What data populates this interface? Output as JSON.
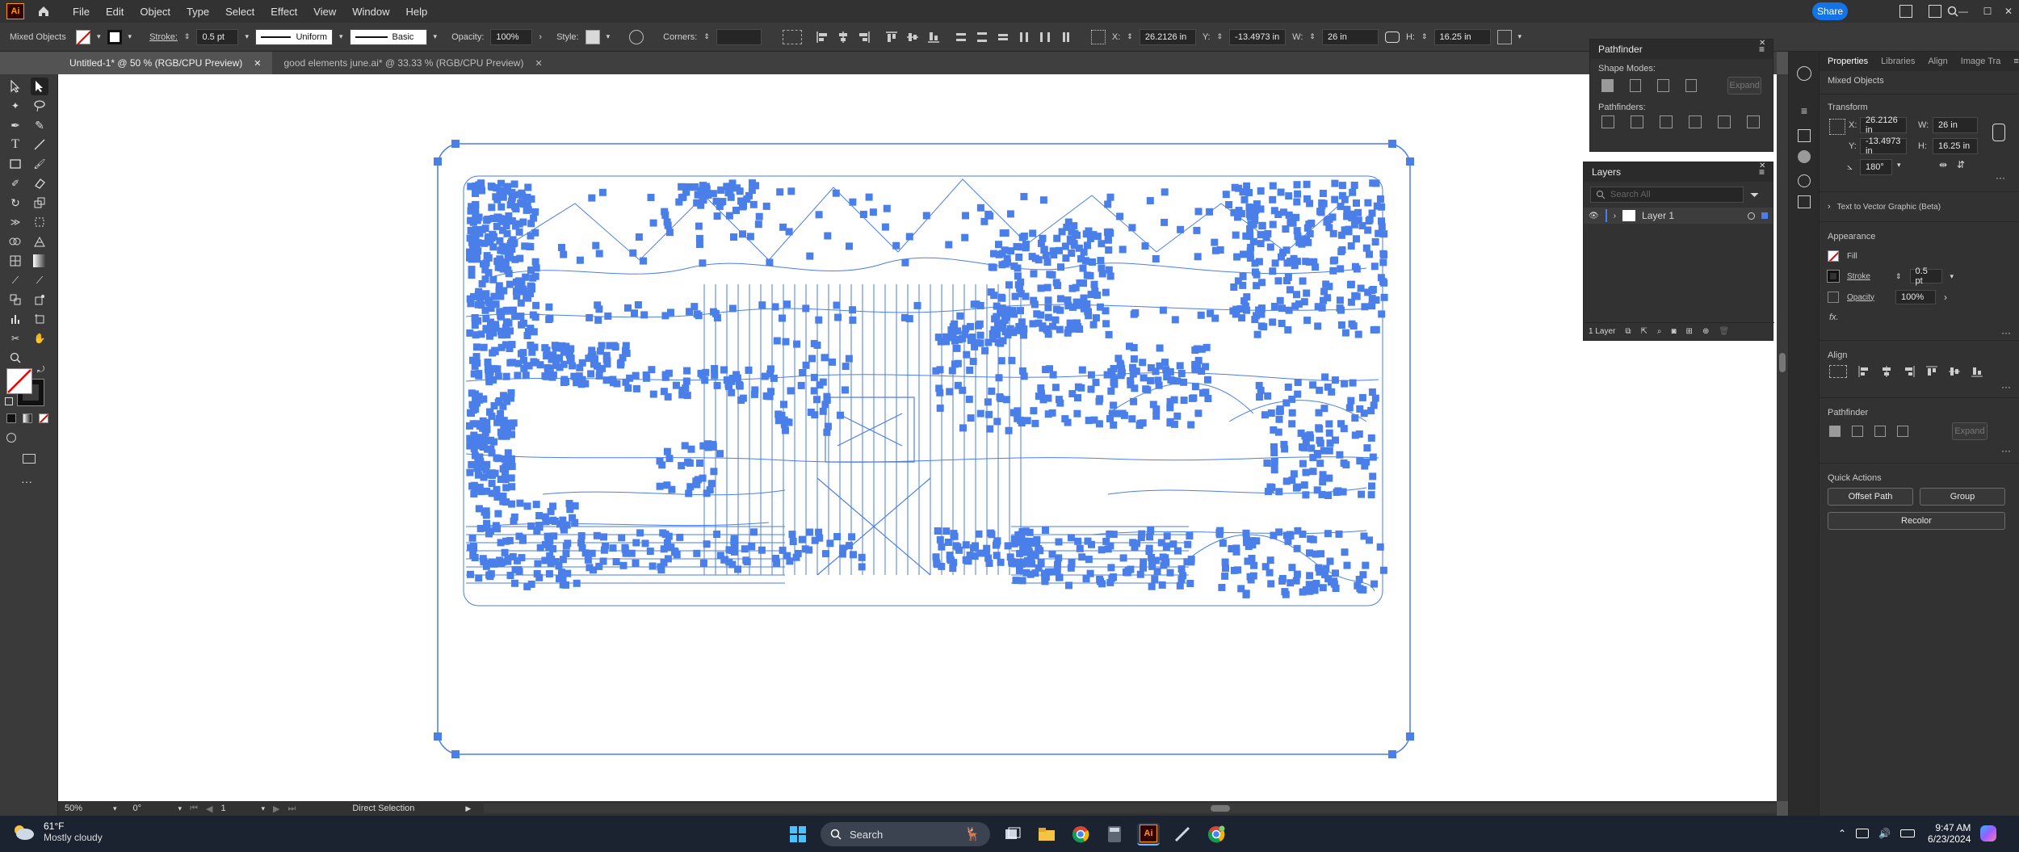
{
  "app": {
    "logo": "Ai",
    "home_icon": "home-icon"
  },
  "menu": [
    "File",
    "Edit",
    "Object",
    "Type",
    "Select",
    "Effect",
    "View",
    "Window",
    "Help"
  ],
  "window": {
    "share_label": "Share"
  },
  "control_bar": {
    "selection_label": "Mixed Objects",
    "stroke_label": "Stroke:",
    "stroke_value": "0.5 pt",
    "profile_value": "Uniform",
    "brush_value": "Basic",
    "opacity_label": "Opacity:",
    "opacity_value": "100%",
    "style_label": "Style:",
    "corners_label": "Corners:",
    "x_label": "X:",
    "x_value": "26.2126 in",
    "y_label": "Y:",
    "y_value": "-13.4973 in",
    "w_label": "W:",
    "w_value": "26 in",
    "h_label": "H:",
    "h_value": "16.25 in"
  },
  "tabs": [
    {
      "label": "Untitled-1* @ 50 % (RGB/CPU Preview)",
      "active": true
    },
    {
      "label": "good elements june.ai* @ 33.33 % (RGB/CPU Preview)",
      "active": false
    }
  ],
  "status_bar": {
    "zoom": "50%",
    "rotation": "0°",
    "artboard": "1",
    "tool": "Direct Selection"
  },
  "pathfinder_panel": {
    "title": "Pathfinder",
    "shape_modes_label": "Shape Modes:",
    "expand_label": "Expand",
    "pathfinders_label": "Pathfinders:"
  },
  "layers_panel": {
    "title": "Layers",
    "search_placeholder": "Search All",
    "layer_name": "Layer 1",
    "layer_count": "1 Layer"
  },
  "properties_panel": {
    "tabs": [
      "Properties",
      "Libraries",
      "Align",
      "Image Tra"
    ],
    "selection": "Mixed Objects",
    "transform_title": "Transform",
    "x_label": "X:",
    "x_value": "26.2126 in",
    "y_label": "Y:",
    "y_value": "-13.4973 in",
    "w_label": "W:",
    "w_value": "26 in",
    "h_label": "H:",
    "h_value": "16.25 in",
    "angle_value": "180°",
    "text_to_vector": "Text to Vector Graphic (Beta)",
    "appearance_title": "Appearance",
    "fill_label": "Fill",
    "stroke_label": "Stroke",
    "stroke_value": "0.5 pt",
    "opacity_label": "Opacity",
    "opacity_value": "100%",
    "fx_label": "fx.",
    "align_title": "Align",
    "pathfinder_title": "Pathfinder",
    "expand_label": "Expand",
    "quick_actions_title": "Quick Actions",
    "offset_path_label": "Offset Path",
    "group_label": "Group",
    "recolor_label": "Recolor"
  },
  "taskbar": {
    "weather_temp": "61°F",
    "weather_desc": "Mostly cloudy",
    "search_label": "Search",
    "time": "9:47 AM",
    "date": "6/23/2024"
  },
  "colors": {
    "selection_blue": "#4a7ee8",
    "ui_dark": "#323232",
    "ui_mid": "#535353",
    "share_blue": "#1473e6",
    "ai_orange": "#ff9a00"
  }
}
